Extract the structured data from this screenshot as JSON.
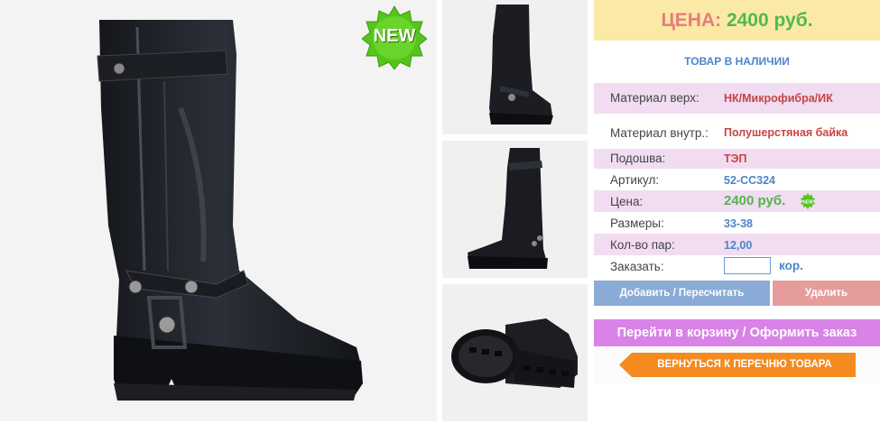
{
  "badge": {
    "new_label": "NEW",
    "mini_label": "NEW"
  },
  "panel": {
    "price_label": "ЦЕНА:",
    "price_value": "2400 руб.",
    "stock_status": "ТОВАР В НАЛИЧИИ",
    "rows": [
      {
        "key": "Материал верх:",
        "value": "НК/Микрофибра/ИК"
      },
      {
        "key": "Материал внутр.:",
        "value": "Полушерстяная байка"
      },
      {
        "key": "Подошва:",
        "value": "ТЭП"
      },
      {
        "key": "Артикул:",
        "value": "52-СС324"
      },
      {
        "key": "Цена:",
        "value": "2400 руб."
      },
      {
        "key": "Размеры:",
        "value": "33-38"
      },
      {
        "key": "Кол-во пар:",
        "value": "12,00"
      },
      {
        "key": "Заказать:",
        "value": ""
      }
    ],
    "qty_unit": "кор.",
    "add_button": "Добавить / Пересчитать",
    "delete_button": "Удалить",
    "cart_button": "Перейти в корзину / Оформить заказ",
    "back_button": "ВЕРНУТЬСЯ К ПЕРЕЧНЮ ТОВАРА"
  },
  "colors": {
    "price_bg": "#fbe9a6",
    "row_alt_bg": "#f1dcf1",
    "add_btn": "#8aabd6",
    "delete_btn": "#e79c9c",
    "cart_btn": "#d982e8",
    "back_btn": "#f58a1f",
    "new_badge": "#55c41c"
  },
  "icons": [
    "new-badge-icon",
    "back-arrow-icon"
  ]
}
